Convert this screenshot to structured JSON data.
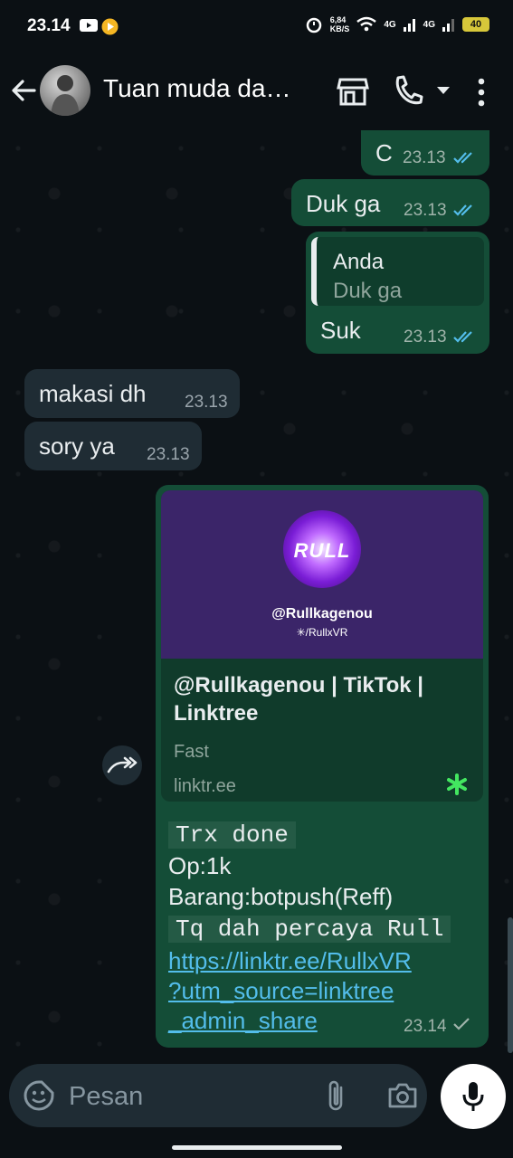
{
  "status_bar": {
    "time": "23.14",
    "network_speed": "6,84\nKB/S",
    "signal_1": "4G",
    "signal_2": "4G",
    "battery": "40"
  },
  "header": {
    "title": "Tuan muda da…"
  },
  "messages": [
    {
      "text": "C",
      "time": "23.13"
    },
    {
      "text": "Duk ga",
      "time": "23.13"
    },
    {
      "reply_author": "Anda",
      "reply_text": "Duk ga",
      "text": "Suk",
      "time": "23.13"
    },
    {
      "text": "makasi dh",
      "time": "23.13"
    },
    {
      "text": "sory ya",
      "time": "23.13"
    }
  ],
  "link_message": {
    "image_logo_word": "RULL",
    "image_handle": "@Rullkagenou",
    "image_sub": "✳/RullxVR",
    "title": "@Rullkagenou | TikTok | Linktree",
    "description": "Fast",
    "domain": "linktr.ee",
    "lines": [
      "Trx done",
      "Op:1k",
      "Barang:botpush(Reff)",
      "Tq dah percaya Rull"
    ],
    "url_lines": [
      "https://linktr.ee/RullxVR",
      "?utm_source=linktree",
      "_admin_share"
    ],
    "time": "23.14"
  },
  "composer": {
    "placeholder": "Pesan"
  },
  "colors": {
    "outgoing_bubble": "#144d37",
    "incoming_bubble": "#1f2c34",
    "read_ticks": "#53bdeb",
    "link": "#53bdeb"
  }
}
